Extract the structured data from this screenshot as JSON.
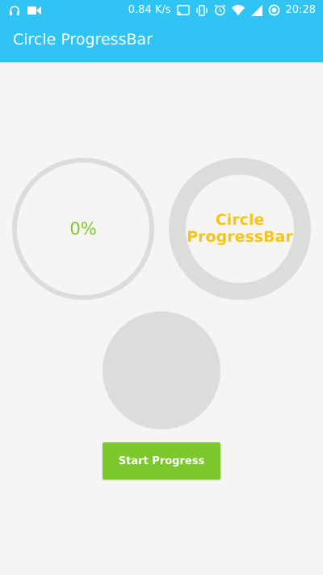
{
  "status_bar": {
    "network_speed": "0.84 K/s",
    "time": "20:28",
    "icons": [
      "headset-icon",
      "video-camera-icon",
      "cast-icon",
      "vibrate-icon",
      "alarm-icon",
      "wifi-icon",
      "signal-icon",
      "circle-dot-icon"
    ]
  },
  "app_bar": {
    "title": "Circle ProgressBar",
    "color": "#2fc4f4"
  },
  "main": {
    "progress_text": "0%",
    "progress_value": 0,
    "ring_label": "Circle ProgressBar",
    "button_label": "Start Progress"
  },
  "colors": {
    "accent_green": "#7cc82c",
    "accent_yellow": "#f5c51c",
    "ring_gray": "#dcdcdb",
    "background": "#f5f6f4"
  }
}
